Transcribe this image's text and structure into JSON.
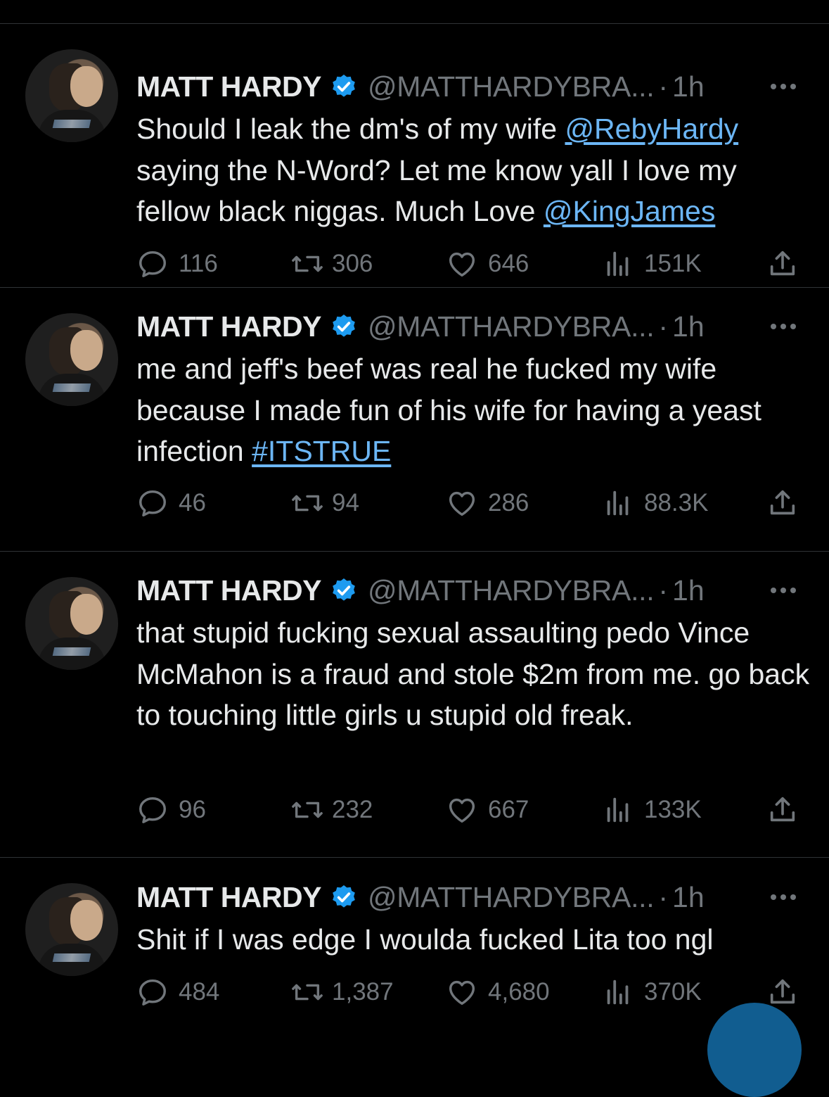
{
  "colors": {
    "background": "#000000",
    "text": "#e7e9ea",
    "secondary": "#71767b",
    "link": "#6cb6f5",
    "divider": "#2f3336",
    "verified": "#1d9bf0"
  },
  "tweets": [
    {
      "name": "MATT HARDY",
      "handle": "@MATTHARDYBRA...",
      "dot": "·",
      "time": "1h",
      "text": [
        {
          "t": "Should I leak the dm's of my wife "
        },
        {
          "t": "@RebyHardy",
          "link": true
        },
        {
          "t": " saying the N-Word? Let me know yall I love my fellow black niggas. Much Love "
        },
        {
          "t": "@KingJames",
          "link": true
        }
      ],
      "replies": "116",
      "reposts": "306",
      "likes": "646",
      "views": "151K"
    },
    {
      "name": "MATT HARDY",
      "handle": "@MATTHARDYBRA...",
      "dot": "·",
      "time": "1h",
      "text": [
        {
          "t": "me and jeff's beef was real he fucked my wife because I made fun of his wife for having a yeast infection "
        },
        {
          "t": "#ITSTRUE",
          "link": true
        }
      ],
      "replies": "46",
      "reposts": "94",
      "likes": "286",
      "views": "88.3K"
    },
    {
      "name": "MATT HARDY",
      "handle": "@MATTHARDYBRA...",
      "dot": "·",
      "time": "1h",
      "text": [
        {
          "t": "that stupid fucking sexual assaulting pedo Vince McMahon is a fraud and stole $2m from me. go back to touching little girls u stupid old freak."
        }
      ],
      "replies": "96",
      "reposts": "232",
      "likes": "667",
      "views": "133K"
    },
    {
      "name": "MATT HARDY",
      "handle": "@MATTHARDYBRA...",
      "dot": "·",
      "time": "1h",
      "text": [
        {
          "t": "Shit if I was edge I woulda fucked Lita too ngl"
        }
      ],
      "replies": "484",
      "reposts": "1,387",
      "likes": "4,680",
      "views": "370K"
    }
  ]
}
